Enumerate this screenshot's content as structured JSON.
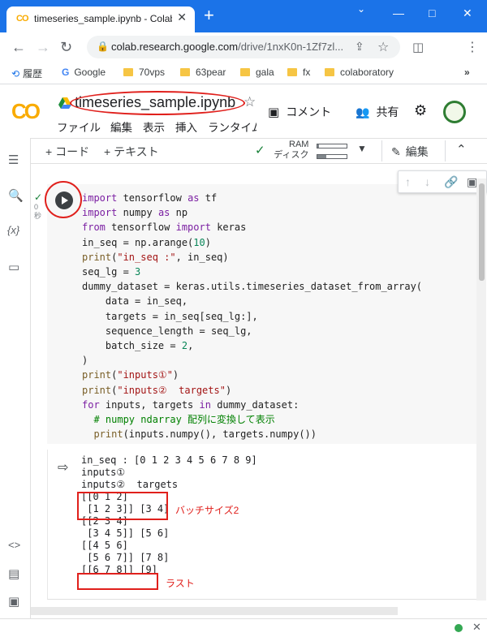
{
  "browser": {
    "tab_title": "timeseries_sample.ipynb - Colab",
    "tab_favicon": "CO",
    "new_tab": "+",
    "url_main": "colab.research.google.com",
    "url_path": "/drive/1nxK0n-1Zf7zl...",
    "window_controls": {
      "minimize": "—",
      "maximize": "□",
      "close": "✕"
    }
  },
  "bookmarks": [
    {
      "label": "履歴",
      "icon": "history-icon"
    },
    {
      "label": "Google",
      "icon": "google-icon"
    },
    {
      "label": "70vps",
      "icon": "folder-icon"
    },
    {
      "label": "63pear",
      "icon": "folder-icon"
    },
    {
      "label": "gala",
      "icon": "folder-icon"
    },
    {
      "label": "fx",
      "icon": "folder-icon"
    },
    {
      "label": "colaboratory",
      "icon": "folder-icon"
    },
    {
      "label": "»",
      "icon": "more-bookmarks-icon"
    }
  ],
  "colab": {
    "logo": "CO",
    "notebook_title": "timeseries_sample.ipynb",
    "menus": [
      "ファイル",
      "編集",
      "表示",
      "挿入",
      "ランタイム"
    ],
    "comment_label": "コメント",
    "share_label": "共有"
  },
  "toolbar": {
    "add_code": "+ コード",
    "add_text": "+ テキスト",
    "ram_label": "RAM",
    "disk_label": "ディスク",
    "ram_usage": 0.05,
    "disk_usage": 0.3,
    "edit_label": "編集"
  },
  "cell": {
    "exec_time_value": "0",
    "exec_time_unit": "秒",
    "code_lines": [
      "import tensorflow as tf",
      "import numpy as np",
      "from tensorflow import keras",
      "in_seq = np.arange(10)",
      "print(\"in_seq :\", in_seq)",
      "seq_lg = 3",
      "dummy_dataset = keras.utils.timeseries_dataset_from_array(",
      "    data = in_seq,",
      "    targets = in_seq[seq_lg:],",
      "    sequence_length = seq_lg,",
      "    batch_size = 2,",
      ")",
      "print(\"inputs①\")",
      "print(\"inputs②  targets\")",
      "for inputs, targets in dummy_dataset:",
      "  # numpy ndarray 配列に変換して表示",
      "  print(inputs.numpy(), targets.numpy())"
    ],
    "output_lines": [
      "in_seq : [0 1 2 3 4 5 6 7 8 9]",
      "inputs①",
      "inputs②  targets",
      "[[0 1 2]",
      " [1 2 3]] [3 4]",
      "[[2 3 4]",
      " [3 4 5]] [5 6]",
      "[[4 5 6]",
      " [5 6 7]] [7 8]",
      "[[6 7 8]] [9]"
    ]
  },
  "annotations": {
    "batch_size_note": "バッチサイズ2",
    "last_note": "ラスト"
  },
  "colors": {
    "accent": "#1b73e8",
    "highlight": "#e0201c",
    "connected": "#34a853"
  }
}
